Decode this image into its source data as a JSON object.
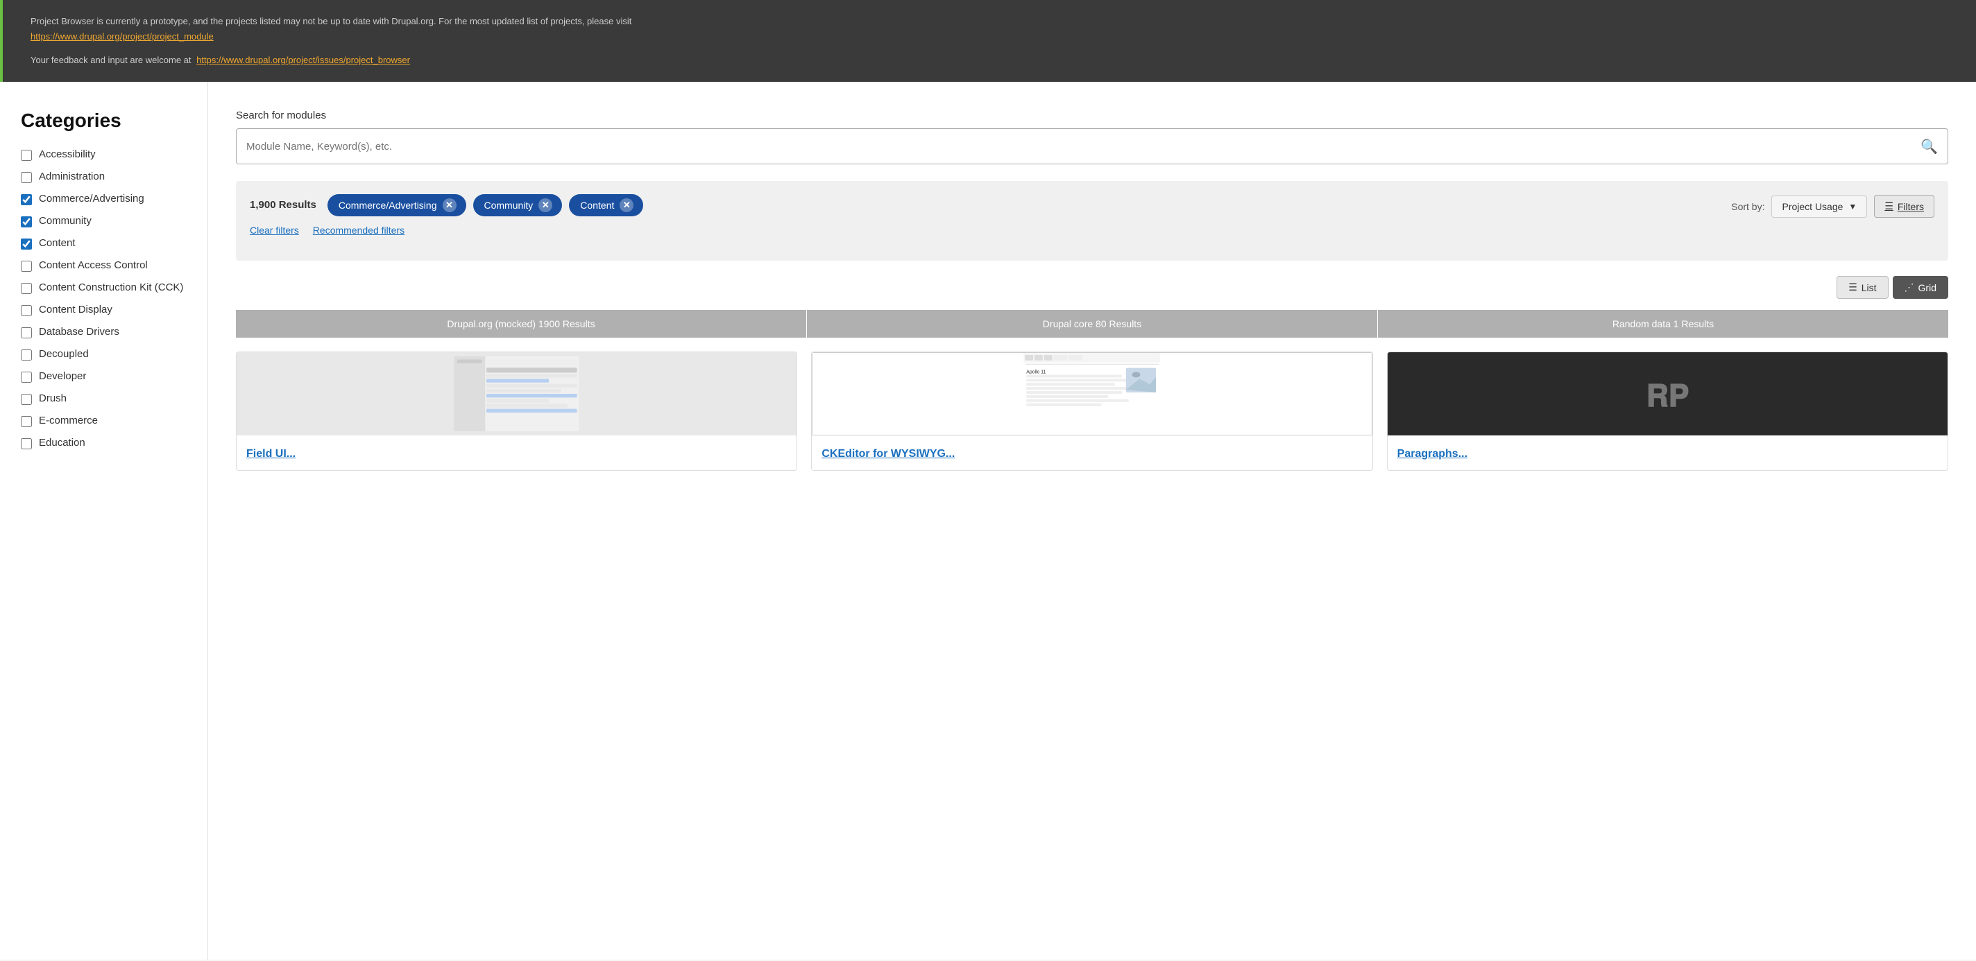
{
  "banner": {
    "text1": "Project Browser is currently a prototype, and the projects listed may not be up to date with Drupal.org. For the most updated list of projects, please visit",
    "link1_text": "https://www.drupal.org/project/project_module",
    "link1_href": "https://www.drupal.org/project/project_module",
    "text2": "Your feedback and input are welcome at",
    "link2_text": "https://www.drupal.org/project/issues/project_browser",
    "link2_href": "https://www.drupal.org/project/issues/project_browser"
  },
  "sidebar": {
    "title": "Categories",
    "categories": [
      {
        "label": "Accessibility",
        "checked": false
      },
      {
        "label": "Administration",
        "checked": false
      },
      {
        "label": "Commerce/Advertising",
        "checked": true
      },
      {
        "label": "Community",
        "checked": true
      },
      {
        "label": "Content",
        "checked": true
      },
      {
        "label": "Content Access Control",
        "checked": false
      },
      {
        "label": "Content Construction Kit (CCK)",
        "checked": false
      },
      {
        "label": "Content Display",
        "checked": false
      },
      {
        "label": "Database Drivers",
        "checked": false
      },
      {
        "label": "Decoupled",
        "checked": false
      },
      {
        "label": "Developer",
        "checked": false
      },
      {
        "label": "Drush",
        "checked": false
      },
      {
        "label": "E-commerce",
        "checked": false
      },
      {
        "label": "Education",
        "checked": false
      }
    ]
  },
  "search": {
    "label": "Search for modules",
    "placeholder": "Module Name, Keyword(s), etc."
  },
  "results": {
    "count": "1,900 Results",
    "filters": [
      {
        "label": "Commerce/Advertising"
      },
      {
        "label": "Community"
      },
      {
        "label": "Content"
      }
    ],
    "clear_filters": "Clear filters",
    "recommended_filters": "Recommended filters"
  },
  "sort": {
    "label": "Sort by:",
    "value": "Project Usage",
    "filters_btn": "Filters"
  },
  "view_toggle": {
    "list_label": "List",
    "grid_label": "Grid"
  },
  "source_tabs": [
    {
      "label": "Drupal.org (mocked) 1900 Results"
    },
    {
      "label": "Drupal core 80 Results"
    },
    {
      "label": "Random data 1 Results"
    }
  ],
  "modules": [
    {
      "title": "Field UI...",
      "type": "browser"
    },
    {
      "title": "CKEditor for WYSIWYG...",
      "type": "apollo"
    },
    {
      "title": "Paragraphs...",
      "type": "tp"
    }
  ]
}
